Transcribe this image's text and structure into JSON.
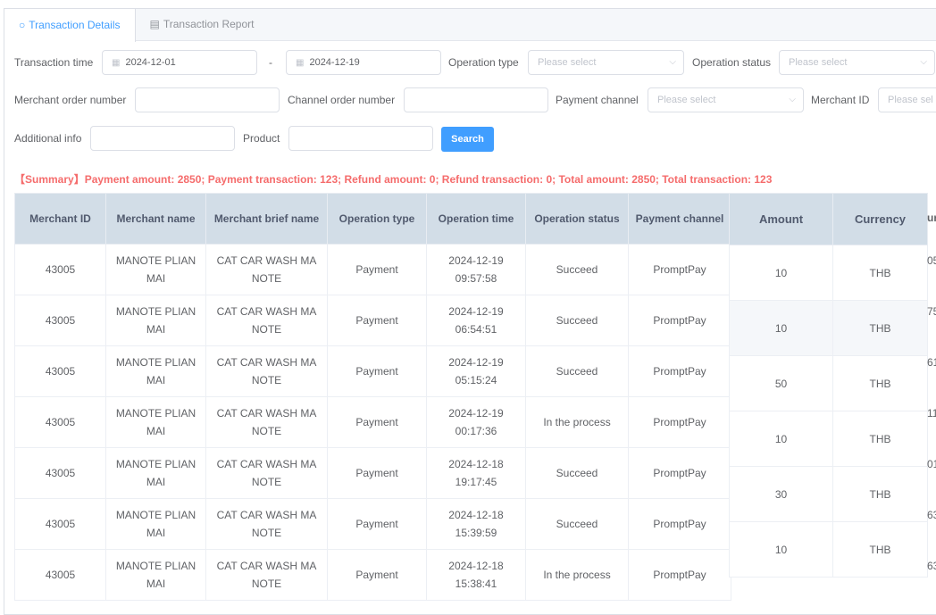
{
  "tabs": [
    {
      "label": "Transaction Details",
      "icon": "search-icon",
      "active": true
    },
    {
      "label": "Transaction Report",
      "icon": "document-icon",
      "active": false
    }
  ],
  "filters": {
    "transaction_time_label": "Transaction time",
    "start_date": "2024-12-01",
    "date_separator": "-",
    "end_date": "2024-12-19",
    "operation_type_label": "Operation type",
    "operation_type_placeholder": "Please select",
    "operation_status_label": "Operation status",
    "operation_status_placeholder": "Please select",
    "merchant_order_label": "Merchant order number",
    "channel_order_label": "Channel order number",
    "payment_channel_label": "Payment channel",
    "payment_channel_placeholder": "Please select",
    "merchant_id_label": "Merchant ID",
    "merchant_id_placeholder": "Please sel",
    "additional_info_label": "Additional info",
    "product_label": "Product",
    "search_label": "Search"
  },
  "summary": "【Summary】Payment amount:  2850;  Payment transaction:  123;  Refund amount:  0;  Refund transaction:  0;  Total amount:  2850;  Total transaction:  123",
  "colors": {
    "accent": "#409eff",
    "summary": "#f56c6c",
    "header_bg": "#d2dde7"
  },
  "table": {
    "columns": [
      "Merchant ID",
      "Merchant name",
      "Merchant brief name",
      "Operation type",
      "Operation time",
      "Operation status",
      "Payment channel"
    ],
    "fixed_columns": [
      "Amount",
      "Currency"
    ],
    "partial_column": "ur",
    "rows": [
      {
        "id": "43005",
        "name": "MANOTE PLIAN MAI",
        "brief": "CAT CAR WASH MA NOTE",
        "type": "Payment",
        "date": "2024-12-19",
        "time": "09:57:58",
        "status": "Succeed",
        "channel": "PromptPay",
        "amount": "10",
        "currency": "THB",
        "partial": "05"
      },
      {
        "id": "43005",
        "name": "MANOTE PLIAN MAI",
        "brief": "CAT CAR WASH MA NOTE",
        "type": "Payment",
        "date": "2024-12-19",
        "time": "06:54:51",
        "status": "Succeed",
        "channel": "PromptPay",
        "amount": "10",
        "currency": "THB",
        "partial": "75"
      },
      {
        "id": "43005",
        "name": "MANOTE PLIAN MAI",
        "brief": "CAT CAR WASH MA NOTE",
        "type": "Payment",
        "date": "2024-12-19",
        "time": "05:15:24",
        "status": "Succeed",
        "channel": "PromptPay",
        "amount": "50",
        "currency": "THB",
        "partial": "61"
      },
      {
        "id": "43005",
        "name": "MANOTE PLIAN MAI",
        "brief": "CAT CAR WASH MA NOTE",
        "type": "Payment",
        "date": "2024-12-19",
        "time": "00:17:36",
        "status": "In the process",
        "channel": "PromptPay",
        "amount": "10",
        "currency": "THB",
        "partial": "11"
      },
      {
        "id": "43005",
        "name": "MANOTE PLIAN MAI",
        "brief": "CAT CAR WASH MA NOTE",
        "type": "Payment",
        "date": "2024-12-18",
        "time": "19:17:45",
        "status": "Succeed",
        "channel": "PromptPay",
        "amount": "30",
        "currency": "THB",
        "partial": "01"
      },
      {
        "id": "43005",
        "name": "MANOTE PLIAN MAI",
        "brief": "CAT CAR WASH MA NOTE",
        "type": "Payment",
        "date": "2024-12-18",
        "time": "15:39:59",
        "status": "Succeed",
        "channel": "PromptPay",
        "amount": "10",
        "currency": "THB",
        "partial": "63"
      },
      {
        "id": "43005",
        "name": "MANOTE PLIAN MAI",
        "brief": "CAT CAR WASH MA NOTE",
        "type": "Payment",
        "date": "2024-12-18",
        "time": "15:38:41",
        "status": "In the process",
        "channel": "PromptPay",
        "partial": "63"
      }
    ]
  }
}
